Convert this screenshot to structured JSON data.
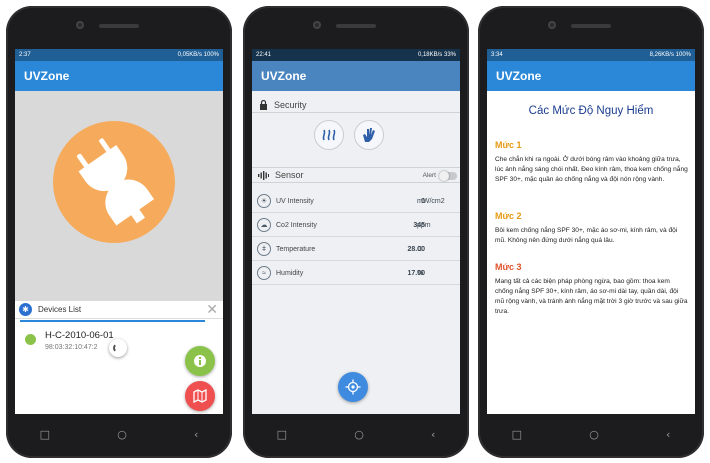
{
  "colors": {
    "appbar_blue": "#2b88d8",
    "statusbar_blue": "#1f5f95",
    "plug_orange": "#f6aa5b",
    "green": "#8bc34a",
    "red": "#ef4f4f",
    "level_orange": "#e69a14",
    "title_blue": "#1b3c8f"
  },
  "phone1": {
    "status": {
      "time": "2:37",
      "net": "0,05KB/s",
      "battery": "100%"
    },
    "app_title": "UVZone",
    "icons": {
      "hero": "plug-disconnected-icon",
      "bluetooth": "bluetooth-icon",
      "close": "close-icon",
      "info_fab": "info-icon",
      "map_fab": "map-icon"
    },
    "devices_list_title": "Devices List",
    "device": {
      "name": "H-C-2010-06-01",
      "mac": "98:03:32:10:47:2"
    }
  },
  "phone2": {
    "status": {
      "time": "22:41",
      "net": "0,18KB/s",
      "battery": "33%"
    },
    "app_title": "UVZone",
    "security_label": "Security",
    "sensor_label": "Sensor",
    "alert_label": "Alert",
    "alert_on": false,
    "icons": {
      "lock": "lock-icon",
      "btn1": "heat-icon",
      "btn2": "hand-icon",
      "sensor": "signal-icon",
      "fab": "gps-icon"
    },
    "metrics": [
      {
        "label": "UV Intensity",
        "value": "0",
        "unit": "mW/cm2",
        "icon": "uv-icon"
      },
      {
        "label": "Co2 Intensity",
        "value": "345",
        "unit": "ppm",
        "icon": "co2-icon"
      },
      {
        "label": "Temperature",
        "value": "28.00",
        "unit": "C",
        "icon": "thermometer-icon"
      },
      {
        "label": "Humidity",
        "value": "17.00",
        "unit": "%",
        "icon": "humidity-icon"
      }
    ]
  },
  "phone3": {
    "status": {
      "time": "3:34",
      "net": "8,26KB/s",
      "battery": "100%"
    },
    "app_title": "UVZone",
    "heading": "Các Mức Độ Nguy Hiểm",
    "levels": [
      {
        "label": "Mức 1",
        "text": "Che chắn khi ra ngoài. Ở dưới bóng râm vào khoảng giữa trưa, lúc ánh nắng sáng chói nhất. Đeo kính râm, thoa kem chống nắng SPF 30+, mặc quần áo chống nắng và đội nón rộng vành."
      },
      {
        "label": "Mức 2",
        "text": "Bôi kem chống nắng SPF 30+, mặc áo sơ-mi, kính râm, và đội mũ. Không nên đứng dưới nắng quá lâu."
      },
      {
        "label": "Mức 3",
        "text": "Mang tất cả các biện pháp phòng ngừa, bao gồm: thoa kem chống nắng SPF 30+, kính râm, áo sơ-mi dài tay, quần dài, đội mũ rộng vành, và tránh ánh nắng mặt trời 3 giờ trước và sau giữa trưa."
      }
    ]
  },
  "navbar": {
    "back": "‹",
    "home": "○",
    "recents": "□"
  }
}
